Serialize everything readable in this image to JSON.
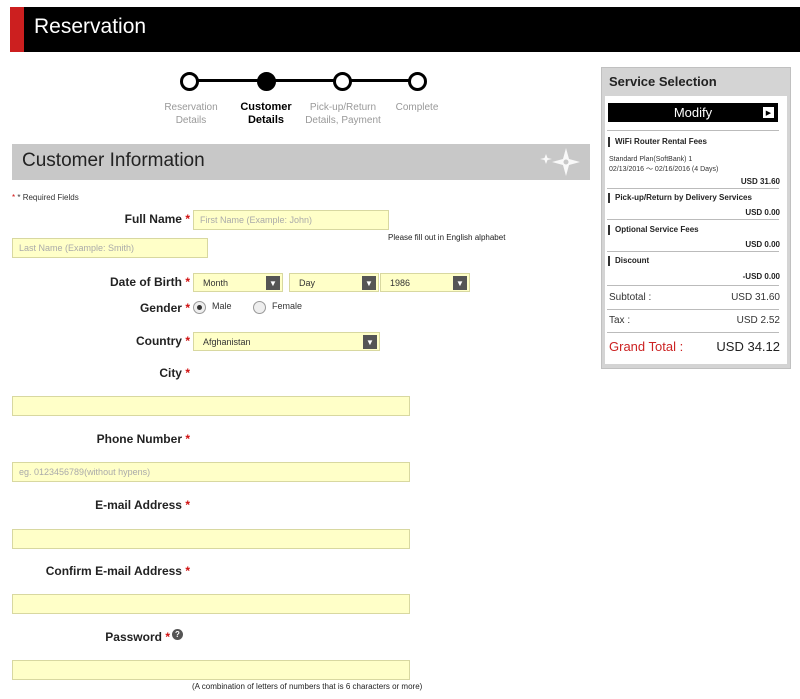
{
  "header": {
    "title": "Reservation"
  },
  "stepper": {
    "steps": [
      {
        "line1": "Reservation",
        "line2": "Details"
      },
      {
        "line1": "Customer",
        "line2": "Details"
      },
      {
        "line1": "Pick-up/Return",
        "line2": "Details, Payment"
      },
      {
        "line1": "Complete",
        "line2": ""
      }
    ],
    "active_index": 1
  },
  "section": {
    "title": "Customer Information"
  },
  "form": {
    "required_note": "* Required Fields",
    "required_mark": "*",
    "full_name": {
      "label": "Full Name",
      "first_placeholder": "First Name (Example: John)",
      "last_placeholder": "Last Name (Example: Smith)",
      "hint": "Please fill out in English alphabet"
    },
    "dob": {
      "label": "Date of Birth",
      "month": "Month",
      "day": "Day",
      "year": "1986"
    },
    "gender": {
      "label": "Gender",
      "male": "Male",
      "female": "Female",
      "selected": "Male"
    },
    "country": {
      "label": "Country",
      "value": "Afghanistan"
    },
    "city": {
      "label": "City",
      "value": ""
    },
    "phone": {
      "label": "Phone Number",
      "placeholder": "eg. 0123456789(without hypens)"
    },
    "email": {
      "label": "E-mail Address",
      "value": ""
    },
    "confirm_email": {
      "label": "Confirm E-mail Address",
      "value": ""
    },
    "password": {
      "label": "Password",
      "help_icon": "question-circle-icon",
      "hint": "(A combination of letters of numbers that is 6 characters or more)"
    }
  },
  "sidebar": {
    "title": "Service Selection",
    "modify_label": "Modify",
    "wifi": {
      "heading": "WiFi Router Rental Fees",
      "plan": "Standard Plan(SoftBank) 1",
      "dates": "02/13/2016 ～ 02/16/2016 (4 Days)",
      "amount": "USD 31.60"
    },
    "pickup": {
      "heading": "Pick-up/Return by Delivery Services",
      "amount": "USD 0.00"
    },
    "optional": {
      "heading": "Optional Service Fees",
      "amount": "USD 0.00"
    },
    "discount": {
      "heading": "Discount",
      "amount": "-USD 0.00"
    },
    "subtotal": {
      "label": "Subtotal :",
      "amount": "USD 31.60"
    },
    "tax": {
      "label": "Tax :",
      "amount": "USD 2.52"
    },
    "grand_total": {
      "label": "Grand Total :",
      "amount": "USD 34.12"
    }
  },
  "colors": {
    "accent_red": "#cc1f1f",
    "field_bg": "#ffffc8",
    "grand_total_red": "#cc2222"
  }
}
